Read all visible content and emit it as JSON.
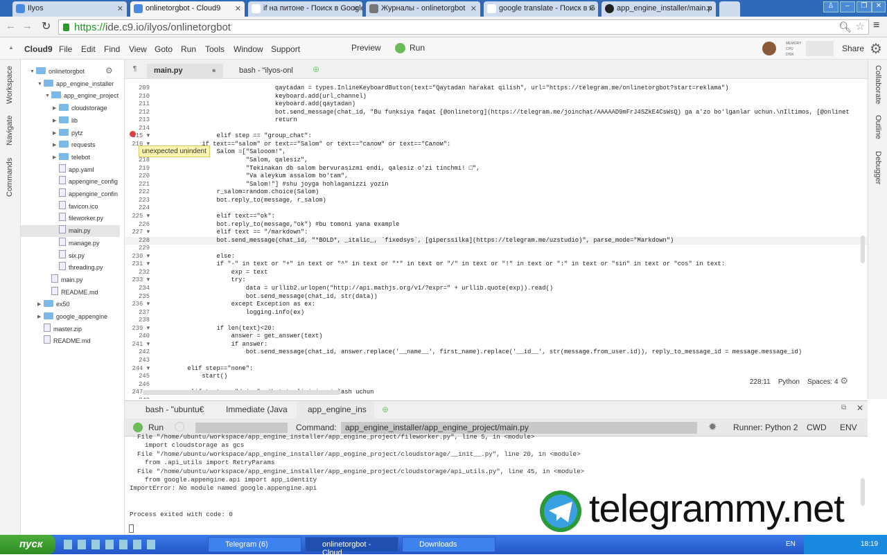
{
  "browser": {
    "tabs": [
      {
        "title": "Ilyos"
      },
      {
        "title": "onlinetorgbot - Cloud9"
      },
      {
        "title": "if на питоне - Поиск в Google"
      },
      {
        "title": "Журналы - onlinetorgbot"
      },
      {
        "title": "google translate - Поиск в G"
      },
      {
        "title": "app_engine_installer/main.p"
      }
    ],
    "url_scheme": "https://",
    "url_rest": "ide.c9.io/ilyos/onlinetorgbot"
  },
  "c9": {
    "menu": [
      "Cloud9",
      "File",
      "Edit",
      "Find",
      "View",
      "Goto",
      "Run",
      "Tools",
      "Window",
      "Support"
    ],
    "preview": "Preview",
    "run": "Run",
    "share": "Share",
    "meters": [
      "MEMORY",
      "CPU",
      "DISK"
    ]
  },
  "sidebars": {
    "left": [
      "Workspace",
      "Navigate",
      "Commands"
    ],
    "right": [
      "Collaborate",
      "Outline",
      "Debugger"
    ]
  },
  "tree": [
    {
      "name": "onlinetorgbot",
      "type": "folder",
      "depth": 0,
      "open": true
    },
    {
      "name": "app_engine_installer",
      "type": "folder",
      "depth": 1,
      "open": true
    },
    {
      "name": "app_engine_project",
      "type": "folder",
      "depth": 2,
      "open": true
    },
    {
      "name": "cloudstorage",
      "type": "folder",
      "depth": 3
    },
    {
      "name": "lib",
      "type": "folder",
      "depth": 3
    },
    {
      "name": "pytz",
      "type": "folder",
      "depth": 3
    },
    {
      "name": "requests",
      "type": "folder",
      "depth": 3
    },
    {
      "name": "telebot",
      "type": "folder",
      "depth": 3
    },
    {
      "name": "app.yaml",
      "type": "file",
      "depth": 3
    },
    {
      "name": "appengine_config",
      "type": "file",
      "depth": 3
    },
    {
      "name": "appengine_confin",
      "type": "file",
      "depth": 3
    },
    {
      "name": "favicon.ico",
      "type": "file",
      "depth": 3
    },
    {
      "name": "fileworker.py",
      "type": "file",
      "depth": 3
    },
    {
      "name": "main.py",
      "type": "file",
      "depth": 3,
      "selected": true
    },
    {
      "name": "manage.py",
      "type": "file",
      "depth": 3
    },
    {
      "name": "six.py",
      "type": "file",
      "depth": 3
    },
    {
      "name": "threading.py",
      "type": "file",
      "depth": 3
    },
    {
      "name": "main.py",
      "type": "file",
      "depth": 2
    },
    {
      "name": "README.md",
      "type": "file",
      "depth": 2
    },
    {
      "name": "ex50",
      "type": "folder",
      "depth": 1
    },
    {
      "name": "google_appengine",
      "type": "folder",
      "depth": 1
    },
    {
      "name": "master.zip",
      "type": "file",
      "depth": 1
    },
    {
      "name": "README.md",
      "type": "file",
      "depth": 1
    }
  ],
  "editor": {
    "tabs": [
      "main.py",
      "bash - \"ilyos-onl"
    ],
    "tooltip": "unexpected unindent",
    "status": {
      "cursor": "228:11",
      "language": "Python",
      "spaces": "Spaces: 4"
    },
    "lines": [
      {
        "n": "209",
        "t": "                                qaytadan = types.InlineKeyboardButton(text=\"Qaytadan harakat qilish\", url=\"https://telegram.me/onlinetorgbot?start=reklama\")"
      },
      {
        "n": "210",
        "t": "                                keyboard.add(url_channel)"
      },
      {
        "n": "211",
        "t": "                                keyboard.add(qaytadan)"
      },
      {
        "n": "212",
        "t": "                                bot.send_message(chat_id, \"Bu funksiya faqat [@onlinetorg](https://telegram.me/joinchat/AAAAAD9mFrJ4SZkE4CsWsQ) ga a'zo bo'lganlar uchun.\\nIltimos, [@onlinet"
      },
      {
        "n": "213",
        "t": "                                return"
      },
      {
        "n": "214",
        "t": ""
      },
      {
        "n": "215 ▾",
        "t": "                elif step == \"group_chat\":"
      },
      {
        "n": "216 ▾",
        "t": "            if text==\"salom\" or text==\"Salom\" or text==\"салом\" or text==\"Салом\":"
      },
      {
        "n": "217",
        "t": "                Salom =[\"Salooom!\","
      },
      {
        "n": "218",
        "t": "                        \"Salom, qalesiz\","
      },
      {
        "n": "219",
        "t": "                        \"Tekinakan db salom bervurasizmi endi, qalesiz o'zi tinchmi! □\","
      },
      {
        "n": "220",
        "t": "                        \"Va aleykum assalom bo'tam\","
      },
      {
        "n": "221",
        "t": "                        \"Salom!\"] #shu joyga hohlaganizzi yozin"
      },
      {
        "n": "222",
        "t": "                r_salom=random.choice(Salom)"
      },
      {
        "n": "223",
        "t": "                bot.reply_to(message, r_salom)"
      },
      {
        "n": "224",
        "t": ""
      },
      {
        "n": "225 ▾",
        "t": "                elif text==\"ok\":"
      },
      {
        "n": "226",
        "t": "                bot.reply_to(message,\"ok\") #bu tomoni yana example"
      },
      {
        "n": "227 ▾",
        "t": "                elif text == \"/markdown\":"
      },
      {
        "n": "228",
        "t": "                bot.send_message(chat_id, \"*BOLD*, _italic_, `fixedsys`, [giperssilka](https://telegram.me/uzstudio)\", parse_mode=\"Markdown\")"
      },
      {
        "n": "229",
        "t": ""
      },
      {
        "n": "230 ▾",
        "t": "                else:"
      },
      {
        "n": "231 ▾",
        "t": "                if \"-\" in text or \"+\" in text or \"^\" in text or \"*\" in text or \"/\" in text or \"!\" in text or \":\" in text or \"sin\" in text or \"cos\" in text:"
      },
      {
        "n": "232",
        "t": "                    exp = text"
      },
      {
        "n": "233 ▾",
        "t": "                    try:"
      },
      {
        "n": "234",
        "t": "                        data = urllib2.urlopen(\"http://api.mathjs.org/v1/?expr=\" + urllib.quote(exp)).read()"
      },
      {
        "n": "235",
        "t": "                        bot.send_message(chat_id, str(data))"
      },
      {
        "n": "236 ▾",
        "t": "                    except Exception as ex:"
      },
      {
        "n": "237",
        "t": "                        logging.info(ex)"
      },
      {
        "n": "238",
        "t": ""
      },
      {
        "n": "239 ▾",
        "t": "                if len(text)<20:"
      },
      {
        "n": "240",
        "t": "                    answer = get_answer(text)"
      },
      {
        "n": "241 ▾",
        "t": "                    if answer:"
      },
      {
        "n": "242",
        "t": "                        bot.send_message(chat_id, answer.replace('__name__', first_name).replace('__id__', str(message.from_user.id)), reply_to_message_id = message.message_id)"
      },
      {
        "n": "243",
        "t": ""
      },
      {
        "n": "244 ▾",
        "t": "        elif step==\"none\":"
      },
      {
        "n": "245",
        "t": "            start()"
      },
      {
        "n": "246",
        "t": ""
      },
      {
        "n": "247 ▾",
        "t": "        elif text == \"/ping\": #bot tezligini aniqlash uchun"
      },
      {
        "n": "248",
        "t": ""
      }
    ]
  },
  "console": {
    "tabs": [
      "bash - \"ubuntu€",
      "Immediate (Java",
      "app_engine_ins"
    ],
    "run": "Run",
    "command_label": "Command:",
    "command": "app_engine_installer/app_engine_project/main.py",
    "runner": "Runner: Python 2",
    "cwd": "CWD",
    "env": "ENV",
    "output": [
      "  File \"/home/ubuntu/workspace/app_engine_installer/app_engine_project/fileworker.py\", line 5, in <module>",
      "    import cloudstorage as gcs",
      "  File \"/home/ubuntu/workspace/app_engine_installer/app_engine_project/cloudstorage/__init__.py\", line 20, in <module>",
      "    from .api_utils import RetryParams",
      "  File \"/home/ubuntu/workspace/app_engine_installer/app_engine_project/cloudstorage/api_utils.py\", line 45, in <module>",
      "    from google.appengine.api import app_identity",
      "ImportError: No module named google.appengine.api",
      "",
      "",
      "Process exited with code: 0"
    ]
  },
  "watermark": "telegrammy.net",
  "taskbar": {
    "start": "пуск",
    "tasks": [
      "Telegram (6)",
      "onlinetorgbot - Cloud...",
      "Downloads"
    ],
    "lang": "EN",
    "clock": "18:19"
  }
}
